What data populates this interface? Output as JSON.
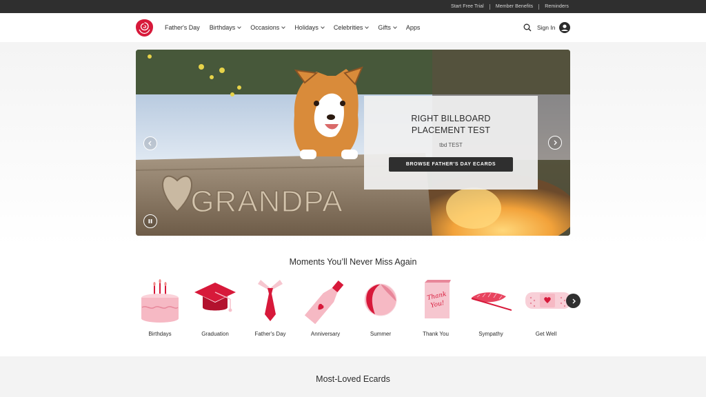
{
  "topbar": {
    "links": [
      "Start Free Trial",
      "Member Benefits",
      "Reminders"
    ]
  },
  "nav": {
    "items": [
      {
        "label": "Father's Day",
        "dropdown": false
      },
      {
        "label": "Birthdays",
        "dropdown": true
      },
      {
        "label": "Occasions",
        "dropdown": true
      },
      {
        "label": "Holidays",
        "dropdown": true
      },
      {
        "label": "Celebrities",
        "dropdown": true
      },
      {
        "label": "Gifts",
        "dropdown": true
      },
      {
        "label": "Apps",
        "dropdown": false
      }
    ],
    "sign_in": "Sign In"
  },
  "hero": {
    "carved_text": "GRANDPA",
    "title_line1": "RIGHT BILLBOARD",
    "title_line2": "PLACEMENT TEST",
    "subtitle": "tbd TEST",
    "cta": "BROWSE FATHER'S DAY ECARDS"
  },
  "moments": {
    "title": "Moments You’ll Never Miss Again",
    "tiles": [
      {
        "label": "Birthdays",
        "icon": "birthday-cake-icon"
      },
      {
        "label": "Graduation",
        "icon": "graduation-cap-icon"
      },
      {
        "label": "Father's Day",
        "icon": "necktie-icon"
      },
      {
        "label": "Anniversary",
        "icon": "champagne-bottle-icon"
      },
      {
        "label": "Summer",
        "icon": "beach-ball-icon"
      },
      {
        "label": "Thank You",
        "icon": "thank-you-card-icon"
      },
      {
        "label": "Sympathy",
        "icon": "feather-icon"
      },
      {
        "label": "Get Well",
        "icon": "bandage-icon"
      }
    ],
    "card_text": "Thank You!"
  },
  "loved": {
    "title": "Most-Loved Ecards"
  },
  "colors": {
    "brand_red": "#d7193a",
    "pink": "#f6c6cf",
    "dark": "#2f2f2f"
  }
}
